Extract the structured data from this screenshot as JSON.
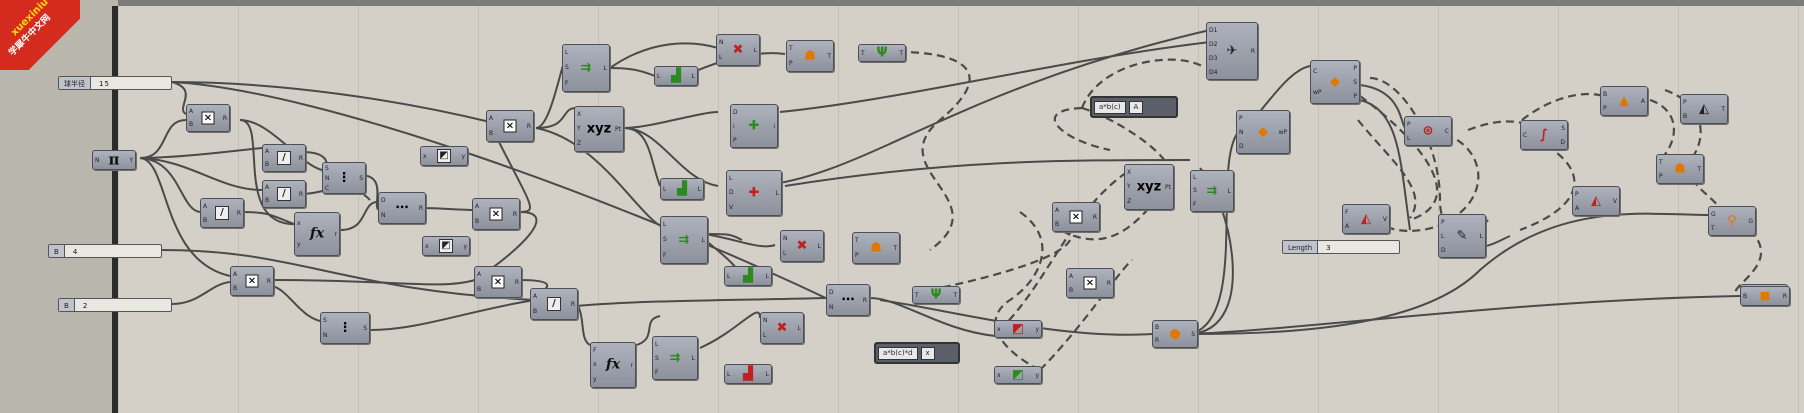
{
  "watermark": {
    "line1": "xuexiniu",
    "line2": "学犀牛中文网"
  },
  "sliders": [
    {
      "label": "球半径",
      "value": "15"
    },
    {
      "label": "B",
      "value": "4"
    },
    {
      "label": "B",
      "value": "2"
    },
    {
      "label": "Length",
      "value": "3"
    }
  ],
  "panels": [
    {
      "text": "a*b(c)",
      "out": "A"
    },
    {
      "text": "a*b(c)*d",
      "out": "x"
    }
  ],
  "components": [
    {
      "id": "pi",
      "icon": "π",
      "ins": [
        "N"
      ],
      "outs": [
        "Y"
      ]
    },
    {
      "id": "mul1",
      "icon": "×",
      "ins": [
        "A",
        "B"
      ],
      "outs": [
        "R"
      ]
    },
    {
      "id": "div1",
      "icon": "/",
      "ins": [
        "A",
        "B"
      ],
      "outs": [
        "R"
      ]
    },
    {
      "id": "div2",
      "icon": "/",
      "ins": [
        "A",
        "B"
      ],
      "outs": [
        "R"
      ]
    },
    {
      "id": "div3",
      "icon": "/",
      "ins": [
        "A",
        "B"
      ],
      "outs": [
        "R"
      ]
    },
    {
      "id": "series1",
      "icon": "⋮",
      "ins": [
        "S",
        "N",
        "C"
      ],
      "outs": [
        "S"
      ]
    },
    {
      "id": "fx1",
      "icon": "fx",
      "ins": [
        "x",
        "y"
      ],
      "outs": [
        "r"
      ]
    },
    {
      "id": "mul2",
      "icon": "×",
      "ins": [
        "A",
        "B"
      ],
      "outs": [
        "R"
      ]
    },
    {
      "id": "series2",
      "icon": "⋮",
      "ins": [
        "S",
        "N"
      ],
      "outs": [
        "S"
      ]
    },
    {
      "id": "range1",
      "icon": "⋯",
      "ins": [
        "D",
        "N"
      ],
      "outs": [
        "R"
      ]
    },
    {
      "id": "grad1",
      "icon": "◩",
      "ins": [
        "x"
      ],
      "outs": [
        "y"
      ]
    },
    {
      "id": "grad2",
      "icon": "◩",
      "ins": [
        "x"
      ],
      "outs": [
        "y"
      ]
    },
    {
      "id": "mul3",
      "icon": "×",
      "ins": [
        "A",
        "B"
      ],
      "outs": [
        "R"
      ]
    },
    {
      "id": "mul4",
      "icon": "×",
      "ins": [
        "A",
        "B"
      ],
      "outs": [
        "R"
      ]
    },
    {
      "id": "mul5",
      "icon": "×",
      "ins": [
        "A",
        "B"
      ],
      "outs": [
        "R"
      ]
    },
    {
      "id": "div4",
      "icon": "/",
      "ins": [
        "A",
        "B"
      ],
      "outs": [
        "R"
      ]
    },
    {
      "id": "line1",
      "icon": "⇉",
      "ins": [
        "L",
        "S",
        "F"
      ],
      "outs": [
        "L"
      ]
    },
    {
      "id": "pt1",
      "icon": "xyz",
      "ins": [
        "X",
        "Y",
        "Z"
      ],
      "outs": [
        "Pt"
      ]
    },
    {
      "id": "list1",
      "icon": "▟",
      "ins": [
        "L"
      ],
      "outs": [
        "L"
      ]
    },
    {
      "id": "list2",
      "icon": "▟",
      "ins": [
        "L"
      ],
      "outs": [
        "L"
      ]
    },
    {
      "id": "cull1",
      "icon": "✖",
      "ins": [
        "N",
        "L"
      ],
      "outs": [
        "L"
      ]
    },
    {
      "id": "tree1",
      "icon": "☗",
      "ins": [
        "T",
        "P"
      ],
      "outs": [
        "T"
      ]
    },
    {
      "id": "graft1",
      "icon": "Ψ",
      "ins": [
        "T"
      ],
      "outs": [
        "T"
      ]
    },
    {
      "id": "merge1",
      "icon": "✚",
      "ins": [
        "D",
        "i",
        "P"
      ],
      "outs": [
        "i"
      ]
    },
    {
      "id": "merge2",
      "icon": "✚",
      "ins": [
        "L",
        "D",
        "V"
      ],
      "outs": [
        "L"
      ]
    },
    {
      "id": "line2",
      "icon": "⇉",
      "ins": [
        "L",
        "S",
        "F"
      ],
      "outs": [
        "L"
      ]
    },
    {
      "id": "list3",
      "icon": "▟",
      "ins": [
        "L"
      ],
      "outs": [
        "L"
      ]
    },
    {
      "id": "cull2",
      "icon": "✖",
      "ins": [
        "N",
        "L"
      ],
      "outs": [
        "L"
      ]
    },
    {
      "id": "tree2",
      "icon": "☗",
      "ins": [
        "T",
        "P"
      ],
      "outs": [
        "T"
      ]
    },
    {
      "id": "graft2",
      "icon": "Ψ",
      "ins": [
        "T"
      ],
      "outs": [
        "T"
      ]
    },
    {
      "id": "fx2",
      "icon": "fx",
      "ins": [
        "F",
        "x",
        "y"
      ],
      "outs": [
        "r"
      ]
    },
    {
      "id": "line3",
      "icon": "⇉",
      "ins": [
        "L",
        "S",
        "F"
      ],
      "outs": [
        "L"
      ]
    },
    {
      "id": "cull3",
      "icon": "✖",
      "ins": [
        "N",
        "L"
      ],
      "outs": [
        "L"
      ]
    },
    {
      "id": "list4",
      "icon": "▟",
      "ins": [
        "L"
      ],
      "outs": [
        "L"
      ]
    },
    {
      "id": "range2",
      "icon": "⋯",
      "ins": [
        "D",
        "N"
      ],
      "outs": [
        "R"
      ]
    },
    {
      "id": "grad3",
      "icon": "◩",
      "ins": [
        "x"
      ],
      "outs": [
        "y"
      ]
    },
    {
      "id": "grad4",
      "icon": "◩",
      "ins": [
        "x"
      ],
      "outs": [
        "y"
      ]
    },
    {
      "id": "mul6",
      "icon": "×",
      "ins": [
        "A",
        "B"
      ],
      "outs": [
        "R"
      ]
    },
    {
      "id": "mul7",
      "icon": "×",
      "ins": [
        "A",
        "B"
      ],
      "outs": [
        "R"
      ]
    },
    {
      "id": "pt2",
      "icon": "xyz",
      "ins": [
        "X",
        "Y",
        "Z"
      ],
      "outs": [
        "Pt"
      ]
    },
    {
      "id": "line4",
      "icon": "⇉",
      "ins": [
        "L",
        "S",
        "F"
      ],
      "outs": [
        "L"
      ]
    },
    {
      "id": "sphere",
      "icon": "●",
      "ins": [
        "B",
        "R"
      ],
      "outs": [
        "S"
      ]
    },
    {
      "id": "dispatch",
      "icon": "✈",
      "ins": [
        "D1",
        "D2",
        "D3",
        "D4"
      ],
      "outs": [
        "R"
      ]
    },
    {
      "id": "pipe1",
      "icon": "◆",
      "ins": [
        "P",
        "N",
        "D"
      ],
      "outs": [
        "wP"
      ]
    },
    {
      "id": "crv1",
      "icon": "◆",
      "ins": [
        "C",
        "wP"
      ],
      "outs": [
        "P",
        "S",
        "P"
      ]
    },
    {
      "id": "arc1",
      "icon": "⊛",
      "ins": [
        "P",
        "L"
      ],
      "outs": [
        "C"
      ]
    },
    {
      "id": "div5",
      "icon": "∫",
      "ins": [
        "C"
      ],
      "outs": [
        "S",
        "D"
      ]
    },
    {
      "id": "tri1",
      "icon": "▲",
      "ins": [
        "B",
        "P"
      ],
      "outs": [
        "A"
      ]
    },
    {
      "id": "join1",
      "icon": "◭",
      "ins": [
        "P",
        "B"
      ],
      "outs": [
        "T"
      ]
    },
    {
      "id": "vec1",
      "icon": "◭",
      "ins": [
        "F",
        "A"
      ],
      "outs": [
        "V"
      ]
    },
    {
      "id": "vec2",
      "icon": "◭",
      "ins": [
        "P",
        "A"
      ],
      "outs": [
        "V"
      ]
    },
    {
      "id": "move1",
      "icon": "✎",
      "ins": [
        "P",
        "L",
        "D"
      ],
      "outs": [
        "L"
      ]
    },
    {
      "id": "tree3",
      "icon": "☗",
      "ins": [
        "T",
        "P"
      ],
      "outs": [
        "T"
      ]
    },
    {
      "id": "mv2",
      "icon": "⚲",
      "ins": [
        "G",
        "T"
      ],
      "outs": [
        "G"
      ]
    },
    {
      "id": "cap1",
      "icon": "◍",
      "ins": [
        "S",
        "T"
      ],
      "outs": [
        "B"
      ]
    },
    {
      "id": "brep1",
      "icon": "◼",
      "ins": [
        "B"
      ],
      "outs": [
        "R"
      ]
    }
  ],
  "colors": {
    "canvas": "#d4d0c8",
    "component": "#9a9ea9",
    "wire": "#4a4a4a"
  }
}
